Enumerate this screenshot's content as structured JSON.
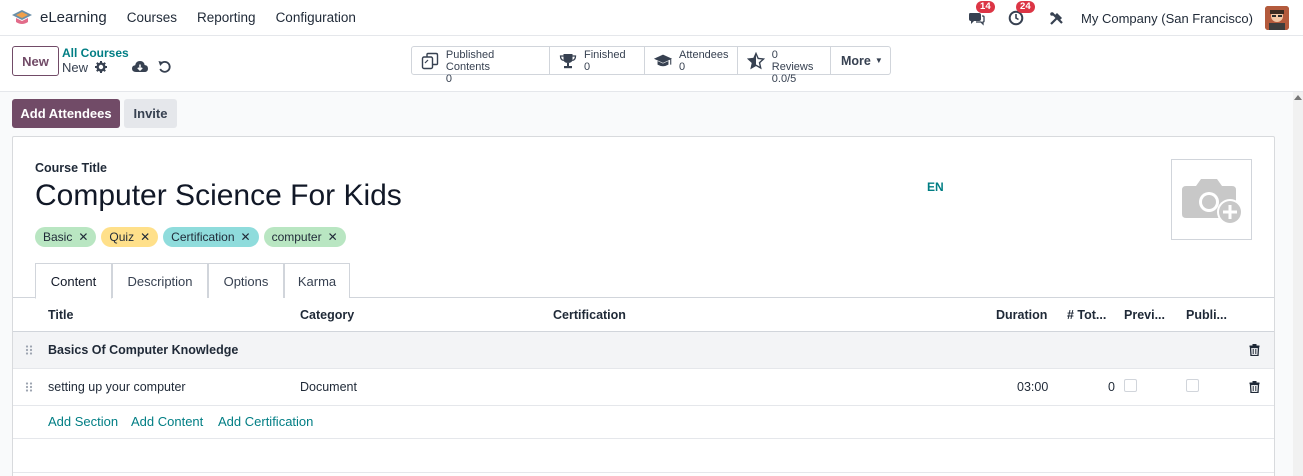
{
  "navbar": {
    "app_name": "eLearning",
    "menu": [
      "Courses",
      "Reporting",
      "Configuration"
    ],
    "messages_count": "14",
    "activities_count": "24",
    "company": "My Company (San Francisco)"
  },
  "control_panel": {
    "new_label": "New",
    "breadcrumb": "All Courses",
    "record_name": "New",
    "stats": [
      {
        "label": "Published Contents",
        "value": "0",
        "icon": "copy-icon"
      },
      {
        "label": "Finished",
        "value": "0",
        "icon": "trophy-icon"
      },
      {
        "label": "Attendees",
        "value": "0",
        "icon": "graduation-cap-icon"
      },
      {
        "label": "0 Reviews",
        "value": "0.0/5",
        "icon": "star-half-icon"
      }
    ],
    "more_label": "More"
  },
  "actions": {
    "add_attendees": "Add Attendees",
    "invite": "Invite"
  },
  "form": {
    "course_title_label": "Course Title",
    "course_title": "Computer Science For Kids",
    "lang": "EN",
    "tags": [
      {
        "label": "Basic",
        "color": "#b9e6c2"
      },
      {
        "label": "Quiz",
        "color": "#ffe08a"
      },
      {
        "label": "Certification",
        "color": "#8fdcdc"
      },
      {
        "label": "computer",
        "color": "#b9e6c2"
      }
    ],
    "tabs": [
      "Content",
      "Description",
      "Options",
      "Karma"
    ],
    "active_tab": "Content"
  },
  "table": {
    "headers": [
      "Title",
      "Category",
      "Certification",
      "Duration",
      "# Tot...",
      "Previ...",
      "Publi..."
    ],
    "section_row": {
      "title": "Basics Of Computer Knowledge"
    },
    "rows": [
      {
        "title": "setting up your computer",
        "category": "Document",
        "certification": "",
        "duration": "03:00",
        "total": "0"
      }
    ],
    "add_links": [
      "Add Section",
      "Add Content",
      "Add Certification"
    ]
  },
  "colors": {
    "brand": "#714b67",
    "link": "#017e84",
    "badge": "#dc3545"
  }
}
